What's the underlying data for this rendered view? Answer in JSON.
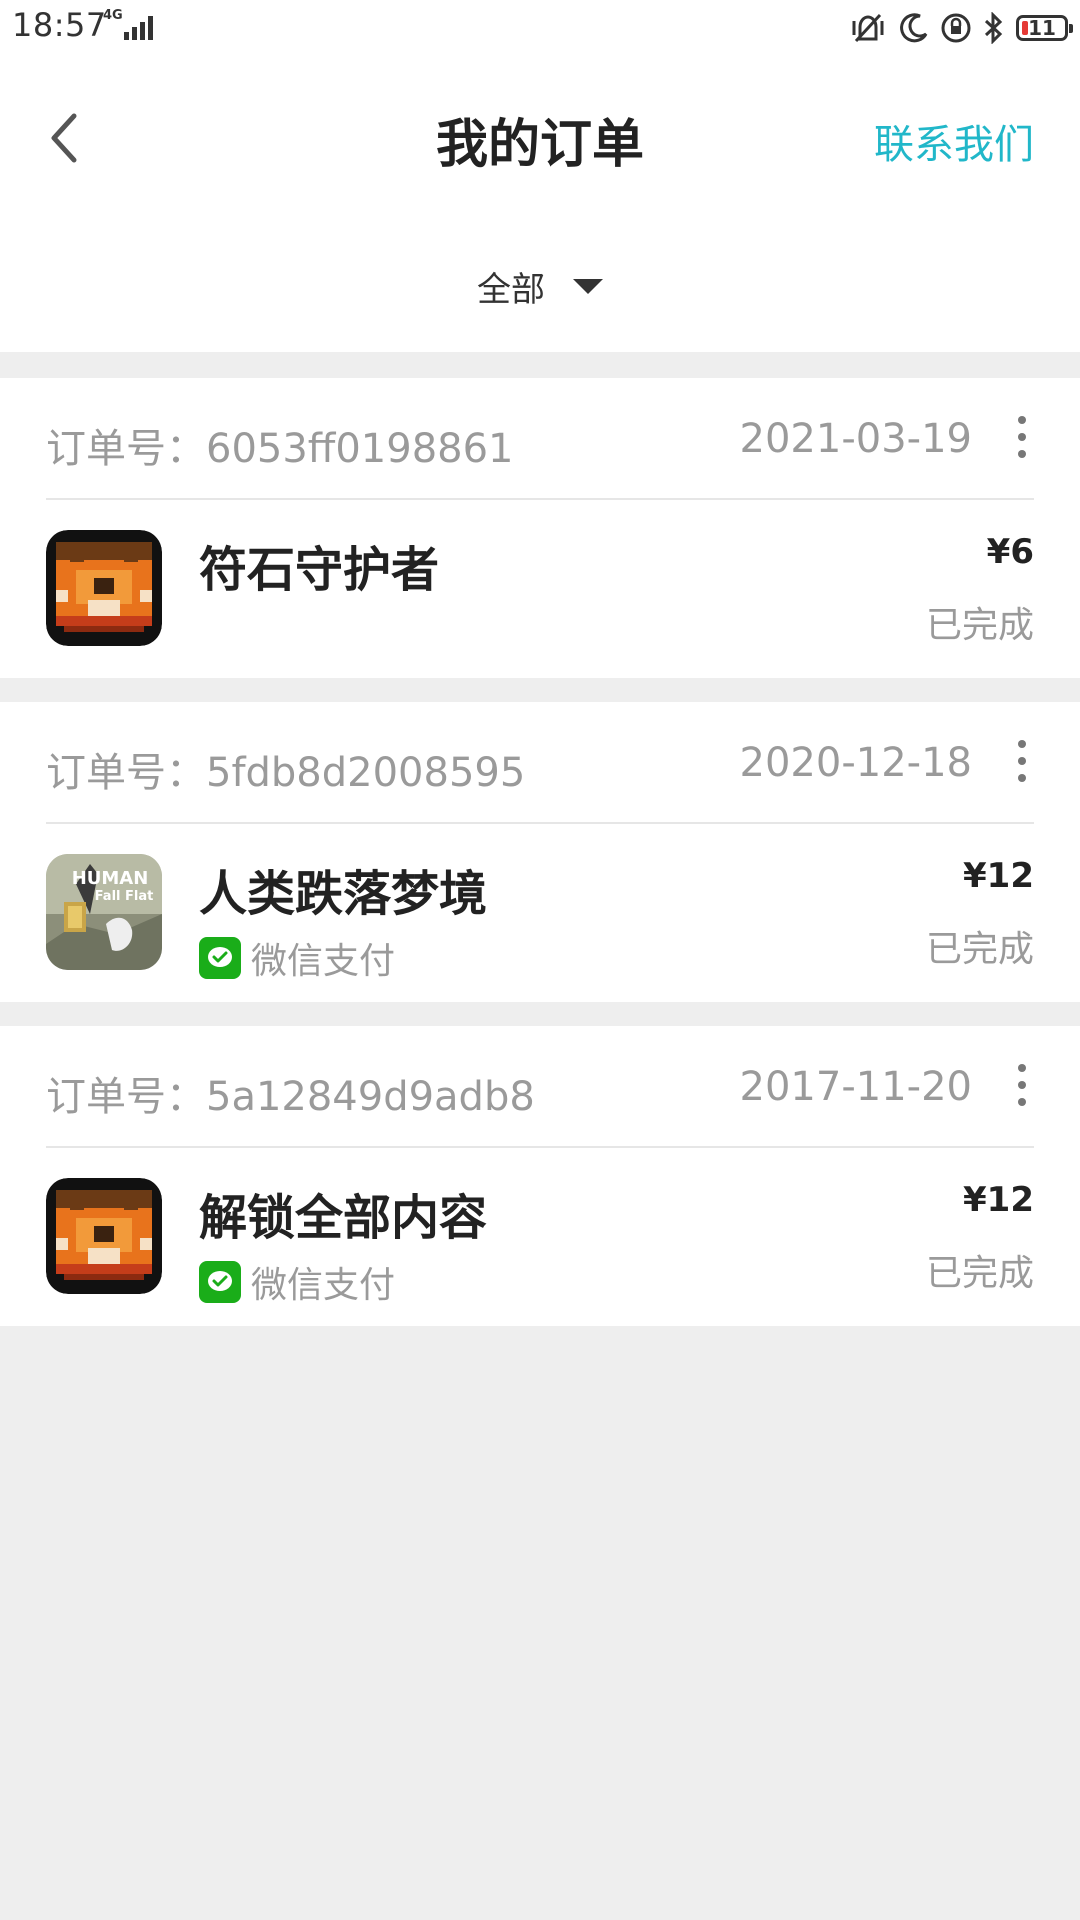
{
  "status_bar": {
    "time": "18:57",
    "network": "4G",
    "battery": "11"
  },
  "header": {
    "title": "我的订单",
    "contact": "联系我们"
  },
  "filter": {
    "label": "全部"
  },
  "orders": [
    {
      "order_no": "订单号：6053ff0198861",
      "date": "2021-03-19",
      "name": "符石守护者",
      "price": "¥6",
      "status": "已完成",
      "payment": "",
      "icon": "rune-guardian-icon"
    },
    {
      "order_no": "订单号：5fdb8d2008595",
      "date": "2020-12-18",
      "name": "人类跌落梦境",
      "price": "¥12",
      "status": "已完成",
      "payment": "微信支付",
      "icon": "human-fall-flat-icon",
      "icon_text": [
        "HUMAN",
        "Fall Flat"
      ]
    },
    {
      "order_no": "订单号：5a12849d9adb8",
      "date": "2017-11-20",
      "name": "解锁全部内容",
      "price": "¥12",
      "status": "已完成",
      "payment": "微信支付",
      "icon": "rune-guardian-icon"
    }
  ],
  "colors": {
    "accent": "#21b7c9",
    "wechat": "#1aad19",
    "background": "#eeeeee"
  }
}
